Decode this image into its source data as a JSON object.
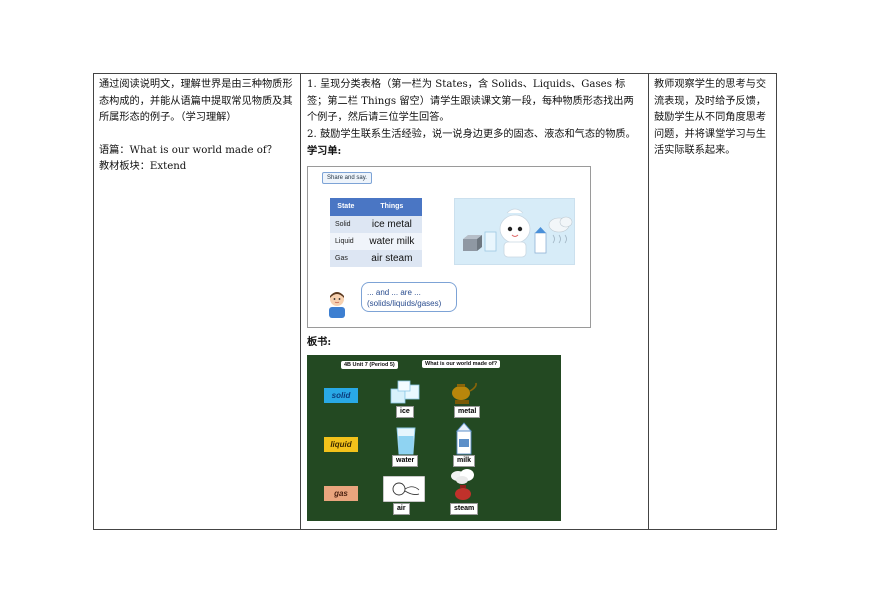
{
  "col1": {
    "objective": "通过阅读说明文，理解世界是由三种物质形态构成的，并能从语篇中提取常见物质及其所属形态的例子。（学习理解）",
    "text_line": "语篇：What is our world made of？",
    "module_line": "教材板块：Extend"
  },
  "col2": {
    "step1": "1.  呈现分类表格（第一栏为 States，含 Solids、Liquids、Gases 标签；第二栏 Things 留空）请学生跟读课文第一段，每种物质形态找出两个例子，然后请三位学生回答。",
    "step2": "2.  鼓励学生联系生活经验，说一说身边更多的固态、液态和气态的物质。",
    "worksheet_label": "学习单:",
    "worksheet": {
      "chip": "Share and say.",
      "headers": [
        "State",
        "Things"
      ],
      "rows": [
        {
          "state": "Solid",
          "things": "ice   metal"
        },
        {
          "state": "Liquid",
          "things": "water   milk"
        },
        {
          "state": "Gas",
          "things": "air   steam"
        }
      ],
      "bubble_line1": "... and ... are ...",
      "bubble_line2": "(solids/liquids/gases)"
    },
    "board_label": "板书:",
    "board": {
      "unit_label": "4B Unit 7 (Period 5)",
      "title_label": "What is our world made of?",
      "categories": [
        {
          "name": "solid",
          "color": "#29a9e6"
        },
        {
          "name": "liquid",
          "color": "#f2c21b"
        },
        {
          "name": "gas",
          "color": "#e9a57e"
        }
      ],
      "words": [
        "ice",
        "metal",
        "water",
        "milk",
        "air",
        "steam"
      ]
    }
  },
  "col3": {
    "note": "教师观察学生的思考与交流表现，及时给予反馈，鼓励学生从不同角度思考问题，并将课堂学习与生活实际联系起来。"
  }
}
